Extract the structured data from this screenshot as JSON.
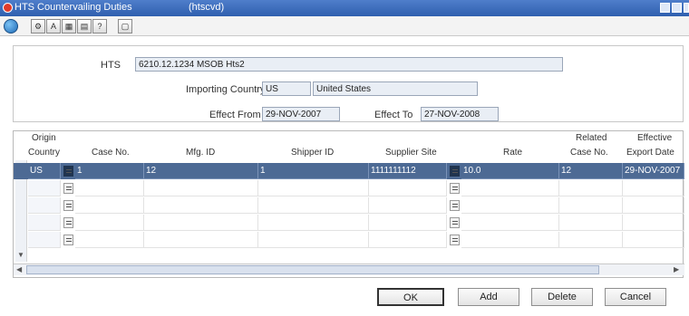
{
  "window": {
    "title": "HTS Countervailing Duties",
    "form_id": "(htscvd)"
  },
  "toolbar": {
    "icons": [
      "globe-icon",
      "tool-icon",
      "spell-icon",
      "table-icon",
      "print-icon",
      "help-icon",
      "window-icon"
    ]
  },
  "header": {
    "hts_label": "HTS",
    "hts_value": "6210.12.1234  MSOB Hts2",
    "country_label": "Importing Country",
    "country_code": "US",
    "country_name": "United States",
    "effect_from_label": "Effect From",
    "effect_from_value": "29-NOV-2007",
    "effect_to_label": "Effect To",
    "effect_to_value": "27-NOV-2008"
  },
  "grid": {
    "headers": {
      "origin_country_1": "Origin",
      "origin_country_2": "Country",
      "case_no": "Case No.",
      "mfg_id": "Mfg. ID",
      "shipper_id": "Shipper ID",
      "supplier_site": "Supplier Site",
      "rate": "Rate",
      "related_case_1": "Related",
      "related_case_2": "Case No.",
      "effective_export_1": "Effective",
      "effective_export_2": "Export Date"
    },
    "rows": [
      {
        "origin_country": "US",
        "case_no": "1",
        "mfg_id": "12",
        "shipper_id": "1",
        "supplier_site": "1111111112",
        "rate": "10.0",
        "related_case": "12",
        "effective_export_date": "29-NOV-2007"
      },
      {
        "origin_country": "",
        "case_no": "",
        "mfg_id": "",
        "shipper_id": "",
        "supplier_site": "",
        "rate": "",
        "related_case": "",
        "effective_export_date": ""
      },
      {
        "origin_country": "",
        "case_no": "",
        "mfg_id": "",
        "shipper_id": "",
        "supplier_site": "",
        "rate": "",
        "related_case": "",
        "effective_export_date": ""
      },
      {
        "origin_country": "",
        "case_no": "",
        "mfg_id": "",
        "shipper_id": "",
        "supplier_site": "",
        "rate": "",
        "related_case": "",
        "effective_export_date": ""
      },
      {
        "origin_country": "",
        "case_no": "",
        "mfg_id": "",
        "shipper_id": "",
        "supplier_site": "",
        "rate": "",
        "related_case": "",
        "effective_export_date": ""
      }
    ]
  },
  "buttons": {
    "ok": "OK",
    "add": "Add",
    "delete": "Delete",
    "cancel": "Cancel"
  },
  "colors": {
    "selected_row": "#4d6a94",
    "titlebar": "#2f5fae"
  }
}
